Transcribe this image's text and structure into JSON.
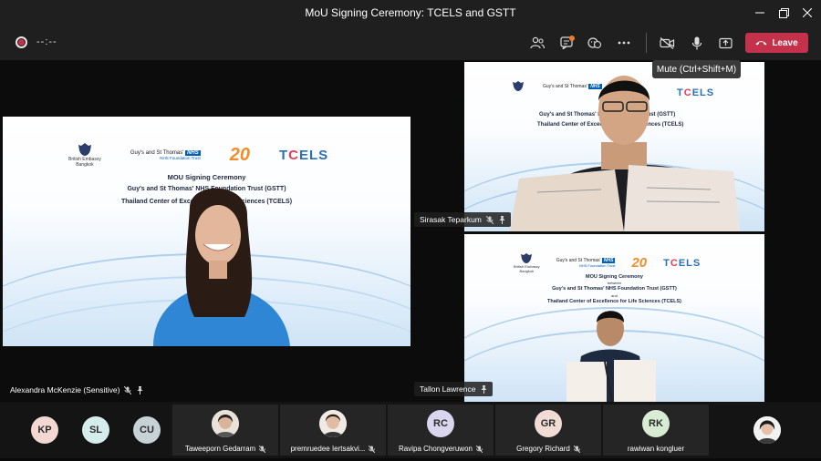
{
  "window": {
    "title": "MoU Signing Ceremony: TCELS and GSTT"
  },
  "toolbar": {
    "timer": "--:--",
    "leave_label": "Leave",
    "icons": [
      "people-icon",
      "chat-icon",
      "reactions-icon",
      "more-icon",
      "camera-off-icon",
      "mic-icon",
      "share-icon",
      "phone-hangup-icon"
    ],
    "leave_color": "#c4314b"
  },
  "tooltip": {
    "text": "Mute (Ctrl+Shift+M)"
  },
  "slide": {
    "embassy": "British Embassy\nBangkok",
    "gst": "Guy's and St Thomas'",
    "nhs": "NHS",
    "nhs_trust": "NHS Foundation Trust",
    "anniversary": "20",
    "tcels": [
      "T",
      "C",
      "ELS"
    ],
    "heading": "MOU Signing Ceremony",
    "between": "between",
    "line1": "Guy's and St Thomas' NHS Foundation Trust (GSTT)",
    "and": "and",
    "line2": "Thailand Center of Excellence for Life Sciences (TCELS)"
  },
  "main_video": {
    "slide_line1": "Guy's and St Thomas' NHS Foundation Trust (GSTT)",
    "slide_line2": "Thailand Center of Excellence for Life Sciences (TCELS)",
    "name": "Alexandra McKenzie (Sensitive)"
  },
  "side_videos": [
    {
      "name": "Sirasak Teparkum",
      "line1": "Guy's and St Thomas' NHS Foundation Trust (GSTT)",
      "line2": "Thailand Center of Excellence for Life Sciences (TCELS)"
    },
    {
      "name": "Tallon Lawrence"
    }
  ],
  "participants": [
    {
      "initials": "KP",
      "color": "#f3d8d2"
    },
    {
      "initials": "SL",
      "color": "#d4ecea"
    },
    {
      "initials": "CU",
      "color": "#c7d2d6"
    },
    {
      "name": "Taweeporn Gedarram",
      "photo": true
    },
    {
      "name": "premruedee Iertsakvi...",
      "photo": true
    },
    {
      "initials": "RC",
      "color": "#d9d6ee",
      "name": "Ravipa Chongveruwon"
    },
    {
      "initials": "GR",
      "color": "#f0dcd4",
      "name": "Gregory Richard"
    },
    {
      "initials": "RK",
      "color": "#d8ecd4",
      "name": "rawiwan kongluer"
    },
    {
      "photo": true
    }
  ]
}
